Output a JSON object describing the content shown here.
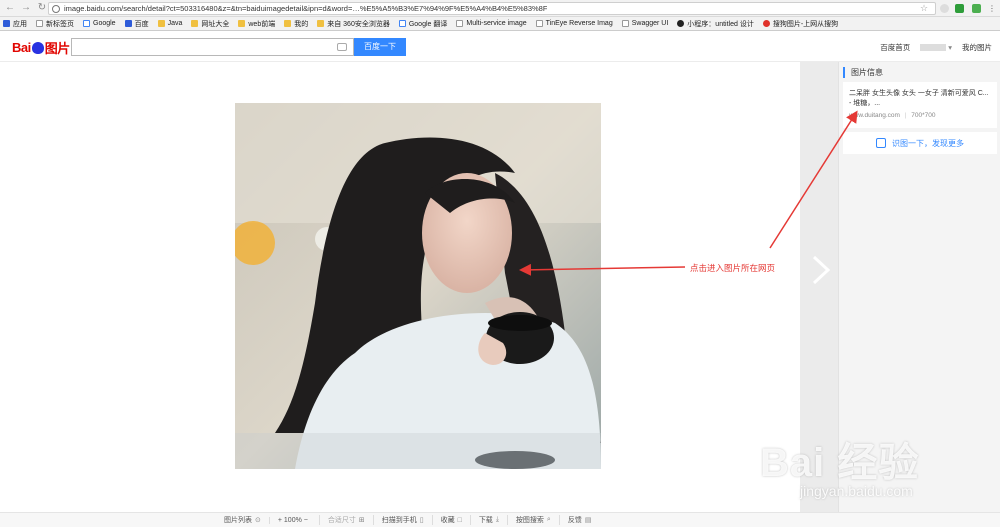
{
  "browser": {
    "url": "image.baidu.com/search/detail?ct=503316480&z=&tn=baiduimagedetail&ipn=d&word=…%E5%A5%B3%E7%94%9F%E5%A4%B4%E5%83%8F"
  },
  "bookmarks": [
    {
      "icon": "apps",
      "label": "应用"
    },
    {
      "icon": "page",
      "label": "新标签页"
    },
    {
      "icon": "google",
      "label": "Google"
    },
    {
      "icon": "baidu",
      "label": "百度"
    },
    {
      "icon": "folder",
      "label": "Java"
    },
    {
      "icon": "folder",
      "label": "网址大全"
    },
    {
      "icon": "folder",
      "label": "web前端"
    },
    {
      "icon": "folder",
      "label": "我的"
    },
    {
      "icon": "folder",
      "label": "来自 360安全浏览器"
    },
    {
      "icon": "google",
      "label": "Google 翻译"
    },
    {
      "icon": "page",
      "label": "Multi-service image"
    },
    {
      "icon": "page",
      "label": "TinEye Reverse Imag"
    },
    {
      "icon": "page",
      "label": "Swagger UI"
    },
    {
      "icon": "dark",
      "label": "小程序：untitled 设计"
    },
    {
      "icon": "red",
      "label": "搜狗图片-上网从搜狗"
    }
  ],
  "header": {
    "logo_text": "Bai",
    "logo_pic": "图片",
    "search_placeholder": "",
    "search_button": "百度一下",
    "link_home": "百度首页",
    "link_mypics": "我的图片"
  },
  "side_panel": {
    "title": "图片信息",
    "desc": "二呆胖 女生头像 女头 一女子 清新可爱风 C... - 堆糖，...",
    "source": "www.duitang.com",
    "size": "700*700",
    "identify_button": "识图一下，发现更多"
  },
  "annotation": {
    "text": "点击进入图片所在网页",
    "color": "#e53935"
  },
  "bottom_bar": [
    {
      "label": "图片列表",
      "suffix": "⊙",
      "dim": false
    },
    {
      "label": "+ 100%  −",
      "suffix": "",
      "dim": false
    },
    {
      "label": "合适尺寸",
      "suffix": "⊞",
      "dim": true
    },
    {
      "label": "扫描到手机",
      "suffix": "▯",
      "dim": false
    },
    {
      "label": "收藏",
      "suffix": "□",
      "dim": false
    },
    {
      "label": "下载",
      "suffix": "⤓",
      "dim": false
    },
    {
      "label": "按图搜索",
      "suffix": "⌕",
      "dim": false
    },
    {
      "label": "反馈",
      "suffix": "▤",
      "dim": false
    }
  ],
  "watermark": {
    "main": "Bai 经验",
    "sub": "jingyan.baidu.com"
  }
}
